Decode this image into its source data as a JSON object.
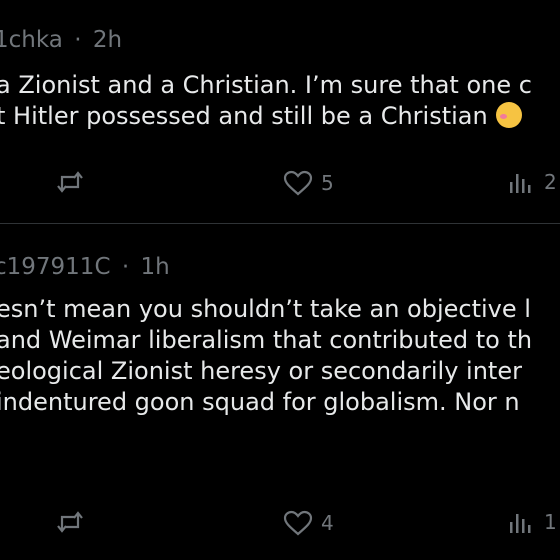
{
  "posts": [
    {
      "handle": "1chka",
      "separator": "·",
      "time": "2h",
      "lines": [
        "a Zionist and a Christian. I’m sure that one c",
        "t Hitler possessed and still be a Christian"
      ],
      "like_count": "5",
      "views_count": "2"
    },
    {
      "handle": "c197911C",
      "separator": "·",
      "time": "1h",
      "lines": [
        "esn’t mean you shouldn’t take an objective l",
        "and Weimar liberalism that contributed to th",
        "eological Zionist heresy or secondarily inter",
        " indentured goon squad for globalism. Nor n"
      ],
      "like_count": "4",
      "views_count": "1"
    }
  ],
  "icons": {
    "repost": "repost-icon",
    "like": "heart-icon",
    "views": "views-icon",
    "emoji": "smiling-face-emoji"
  },
  "colors": {
    "background": "#000000",
    "text": "#e7e9ea",
    "muted": "#71767b",
    "divider": "#2f3336"
  }
}
